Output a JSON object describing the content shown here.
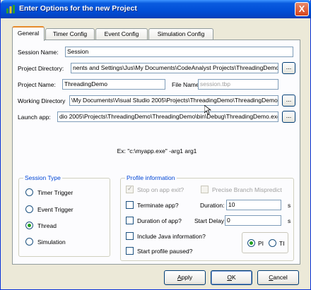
{
  "window": {
    "title": "Enter Options for the new Project",
    "close_label": "X"
  },
  "tabs": [
    {
      "label": "General",
      "active": true
    },
    {
      "label": "Timer Config",
      "active": false
    },
    {
      "label": "Event Config",
      "active": false
    },
    {
      "label": "Simulation Config",
      "active": false
    }
  ],
  "general": {
    "session_name_label": "Session Name:",
    "session_name_value": "Session",
    "project_directory_label": "Project Directory:",
    "project_directory_value": "nents and Settings\\Jus\\My Documents\\CodeAnalyst Projects\\ThreadingDemo",
    "project_name_label": "Project Name:",
    "project_name_value": "ThreadingDemo",
    "file_name_label": "File Name:",
    "file_name_value": "session.tbp",
    "working_directory_label": "Working Directory",
    "working_directory_value": "\\My Documents\\Visual Studio 2005\\Projects\\ThreadingDemo\\ThreadingDemo",
    "launch_app_label": "Launch app:",
    "launch_app_value": "dio 2005\\Projects\\ThreadingDemo\\ThreadingDemo\\bin\\Debug\\ThreadingDemo.exe\"",
    "browse_label": "...",
    "example_text": "Ex: \"c:\\myapp.exe\" -arg1 arg1"
  },
  "session_type": {
    "title": "Session Type",
    "options": [
      {
        "label": "Timer Trigger",
        "selected": false
      },
      {
        "label": "Event Trigger",
        "selected": false
      },
      {
        "label": "Thread",
        "selected": true
      },
      {
        "label": "Simulation",
        "selected": false
      }
    ]
  },
  "profile": {
    "title": "Profile information",
    "stop_on_exit_label": "Stop on app exit?",
    "stop_on_exit_checked": true,
    "precise_branch_label": "Precise Branch Mispredict",
    "precise_branch_checked": false,
    "terminate_label": "Terminate app?",
    "terminate_checked": false,
    "duration_label": "Duration:",
    "duration_value": "10",
    "duration_unit": "s",
    "duration_of_app_label": "Duration of app?",
    "duration_of_app_checked": false,
    "start_delay_label": "Start Delay",
    "start_delay_value": "0",
    "start_delay_unit": "s",
    "java_label": "Include Java information?",
    "java_checked": false,
    "start_paused_label": "Start profile paused?",
    "start_paused_checked": false,
    "pi_label": "PI",
    "pi_selected": true,
    "ti_label": "TI",
    "ti_selected": false
  },
  "buttons": {
    "apply_first": "A",
    "apply_rest": "pply",
    "ok_first": "O",
    "ok_rest": "K",
    "cancel_first": "C",
    "cancel_rest": "ancel"
  },
  "colors": {
    "title_bar": "#0250d8",
    "group_title": "#0046d5",
    "radio_dot": "#21a121",
    "tab_accent": "#e68b2c"
  }
}
